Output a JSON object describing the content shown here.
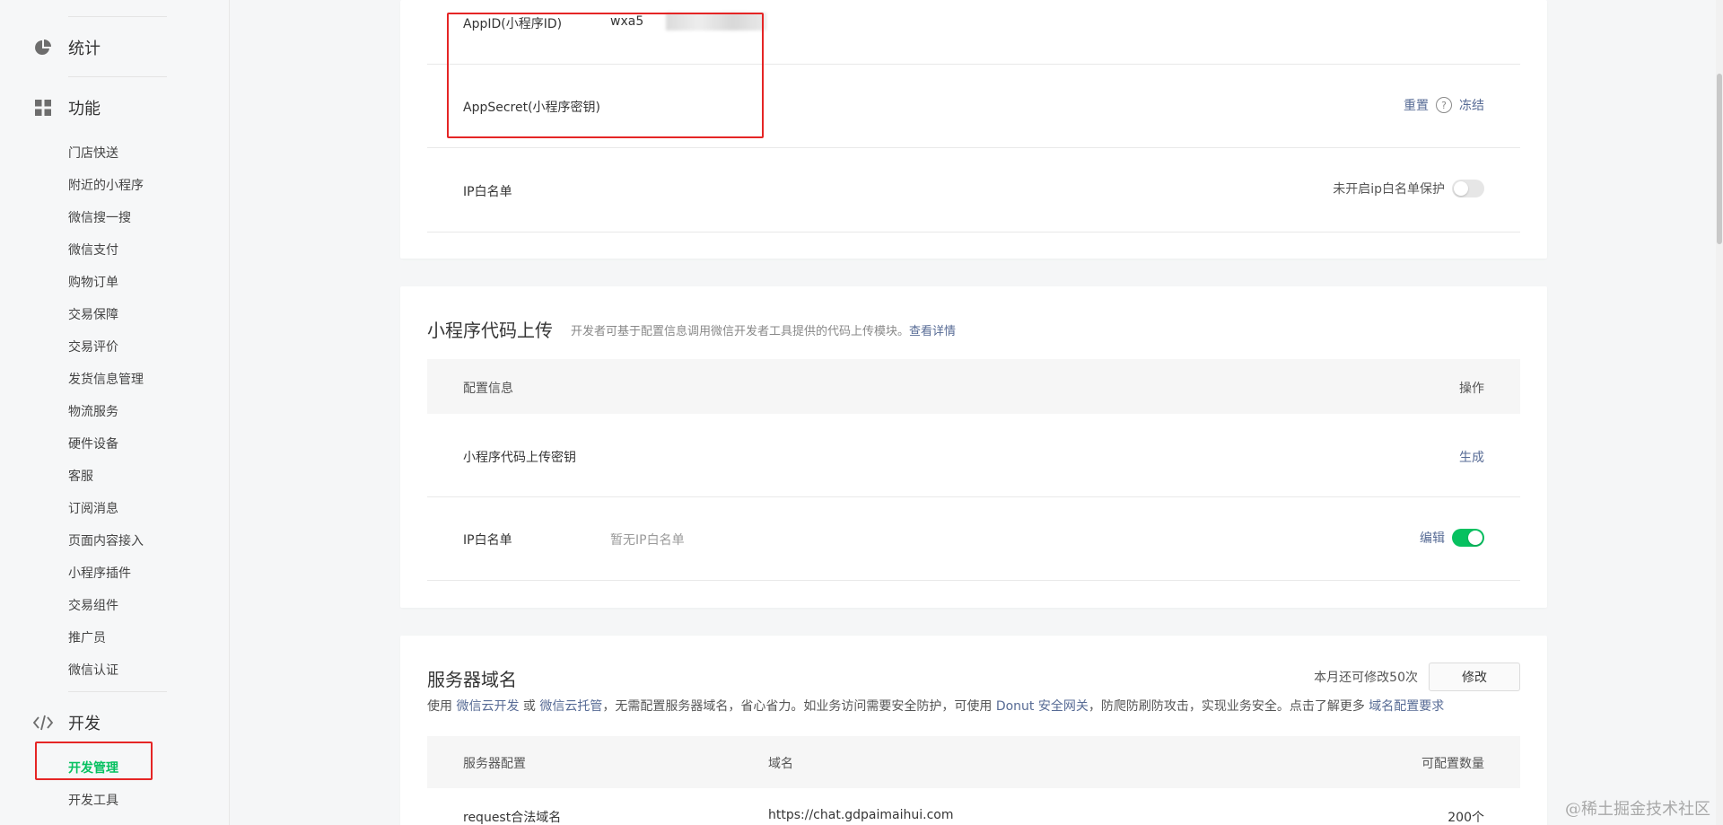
{
  "sidebar": {
    "groups": {
      "stats": {
        "label": "统计",
        "icon": "pie-chart-icon"
      },
      "features": {
        "label": "功能",
        "icon": "grid-icon"
      },
      "dev": {
        "label": "开发",
        "icon": "code-icon"
      }
    },
    "feature_items": [
      "门店快送",
      "附近的小程序",
      "微信搜一搜",
      "微信支付",
      "购物订单",
      "交易保障",
      "交易评价",
      "发货信息管理",
      "物流服务",
      "硬件设备",
      "客服",
      "订阅消息",
      "页面内容接入",
      "小程序插件",
      "交易组件",
      "推广员",
      "微信认证"
    ],
    "dev_items": {
      "active": "开发管理",
      "tools": "开发工具"
    }
  },
  "account": {
    "appid_label": "AppID(小程序ID)",
    "appid_value": "wxa5",
    "secret_label": "AppSecret(小程序密钥)",
    "reset": "重置",
    "help_glyph": "?",
    "freeze": "冻结",
    "ip_label": "IP白名单",
    "ip_status": "未开启ip白名单保护"
  },
  "upload": {
    "title": "小程序代码上传",
    "desc": "开发者可基于配置信息调用微信开发者工具提供的代码上传模块。",
    "details_link": "查看详情",
    "col_config": "配置信息",
    "col_action": "操作",
    "key_label": "小程序代码上传密钥",
    "generate": "生成",
    "ip_label": "IP白名单",
    "ip_value": "暂无IP白名单",
    "edit": "编辑"
  },
  "server": {
    "title": "服务器域名",
    "quota": "本月还可修改50次",
    "modify": "修改",
    "desc_1": "使用",
    "link_cloud": "微信云开发",
    "desc_or": "或",
    "link_hosting": "微信云托管",
    "desc_2": "，无需配置服务器域名，省心省力。如业务访问需要安全防护，可使用",
    "link_donut": "Donut 安全网关",
    "desc_3": "，防爬防刷防攻击，实现业务安全。点击了解更多",
    "link_req": "域名配置要求",
    "col_config": "服务器配置",
    "col_domain": "域名",
    "col_count": "可配置数量",
    "row_type": "request合法域名",
    "row_domain": "https://chat.gdpaimaihui.com",
    "row_count": "200个"
  },
  "watermark": "@稀土掘金技术社区",
  "colors": {
    "accent_green": "#07c160",
    "link_blue": "#576b95",
    "annotation_red": "#e52525"
  }
}
